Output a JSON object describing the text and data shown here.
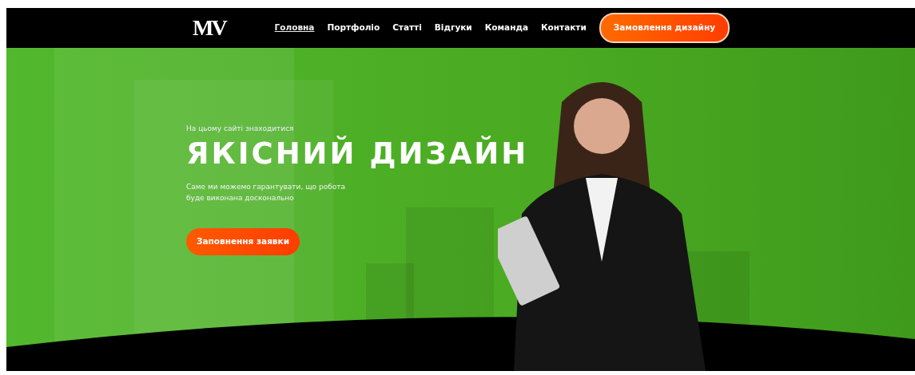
{
  "logo": "MV",
  "nav": [
    {
      "label": "Головна",
      "selected": true
    },
    {
      "label": "Портфоліо",
      "selected": false
    },
    {
      "label": "Статті",
      "selected": false
    },
    {
      "label": "Відгуки",
      "selected": false
    },
    {
      "label": "Команда",
      "selected": false
    },
    {
      "label": "Контакти",
      "selected": false
    }
  ],
  "order_button": "Замовлення дизайну",
  "hero": {
    "subtitle": "На цьому сайті знаходитися",
    "title": "ЯКІСНИЙ ДИЗАЙН",
    "description": "Саме ми можемо гарантувати, що робота буде виконана досконально",
    "button": "Заповнення заявки"
  }
}
